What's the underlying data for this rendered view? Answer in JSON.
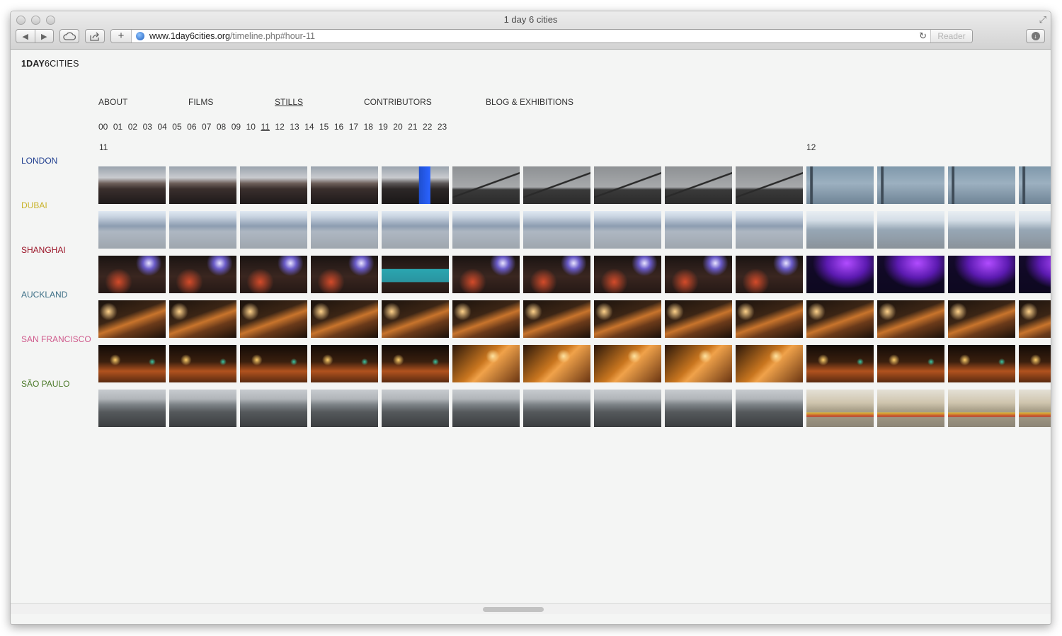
{
  "window": {
    "title": "1 day 6 cities"
  },
  "toolbar": {
    "back_glyph": "◀",
    "forward_glyph": "▶",
    "cloud_icon": "cloud-icon",
    "share_icon": "share-icon",
    "add_glyph": "+",
    "url_domain": "www.1day6cities.org",
    "url_path": "/timeline.php#hour-11",
    "reload_glyph": "↻",
    "reader_label": "Reader",
    "downloads_glyph": "↓"
  },
  "site": {
    "logo_bold": "1DAY",
    "logo_rest": "6CITIES",
    "nav": [
      "ABOUT",
      "FILMS",
      "STILLS",
      "CONTRIBUTORS",
      "BLOG & EXHIBITIONS"
    ],
    "nav_active": "STILLS",
    "hours": [
      "00",
      "01",
      "02",
      "03",
      "04",
      "05",
      "06",
      "07",
      "08",
      "09",
      "10",
      "11",
      "12",
      "13",
      "14",
      "15",
      "16",
      "17",
      "18",
      "19",
      "20",
      "21",
      "22",
      "23"
    ],
    "current_hour": "11",
    "timeline_labels": [
      "11",
      "12"
    ],
    "cities": [
      {
        "name": "LONDON",
        "color": "#1f3e8f"
      },
      {
        "name": "DUBAI",
        "color": "#c9b32a"
      },
      {
        "name": "SHANGHAI",
        "color": "#9a1326"
      },
      {
        "name": "AUCKLAND",
        "color": "#3d6f86"
      },
      {
        "name": "SAN FRANCISCO",
        "color": "#cf5a8c"
      },
      {
        "name": "SÃO PAULO",
        "color": "#4c7a2a"
      }
    ]
  },
  "stills": {
    "columns": 14,
    "hour_11_count": 10,
    "rows": [
      {
        "city": "LONDON",
        "scenes": [
          "crowd-stage",
          "crowd-stage",
          "crowd-stage",
          "crowd-stage",
          "crowd-stage-blue",
          "river-bridge",
          "river-bridge",
          "river-bridge",
          "river-bridge",
          "river-bridge",
          "misty-pier",
          "misty-pier",
          "misty-pier",
          "misty-pier"
        ]
      },
      {
        "city": "DUBAI",
        "scenes": [
          "plaza-people",
          "plaza-people",
          "plaza-people",
          "plaza-people",
          "plaza-people",
          "plaza-people",
          "plaza-people",
          "plaza-people",
          "plaza-people",
          "plaza-people",
          "beach-birds",
          "beach-birds",
          "beach-birds",
          "beach-birds"
        ]
      },
      {
        "city": "SHANGHAI",
        "scenes": [
          "night-street",
          "night-street",
          "night-street",
          "night-street",
          "night-bus",
          "night-street",
          "night-street",
          "night-street",
          "night-street",
          "night-street",
          "purple-tunnel",
          "purple-tunnel",
          "purple-tunnel",
          "purple-tunnel"
        ]
      },
      {
        "city": "AUCKLAND",
        "scenes": [
          "night-road",
          "night-road",
          "night-road",
          "night-road",
          "night-road",
          "night-road",
          "night-road",
          "night-road",
          "night-road",
          "night-road",
          "night-road",
          "night-road",
          "night-road",
          "night-road"
        ]
      },
      {
        "city": "SAN FRANCISCO",
        "scenes": [
          "night-intersection",
          "night-intersection",
          "night-intersection",
          "night-intersection",
          "night-intersection",
          "night-hill",
          "night-hill",
          "night-hill",
          "night-hill",
          "night-hill",
          "night-intersection",
          "night-intersection",
          "night-intersection",
          "night-intersection"
        ]
      },
      {
        "city": "SÃO PAULO",
        "scenes": [
          "grey-skyline",
          "grey-skyline",
          "grey-skyline",
          "grey-skyline",
          "grey-skyline",
          "grey-skyline",
          "grey-skyline",
          "grey-skyline",
          "grey-skyline",
          "grey-skyline",
          "busy-street",
          "busy-street",
          "busy-street",
          "busy-street"
        ]
      }
    ]
  }
}
